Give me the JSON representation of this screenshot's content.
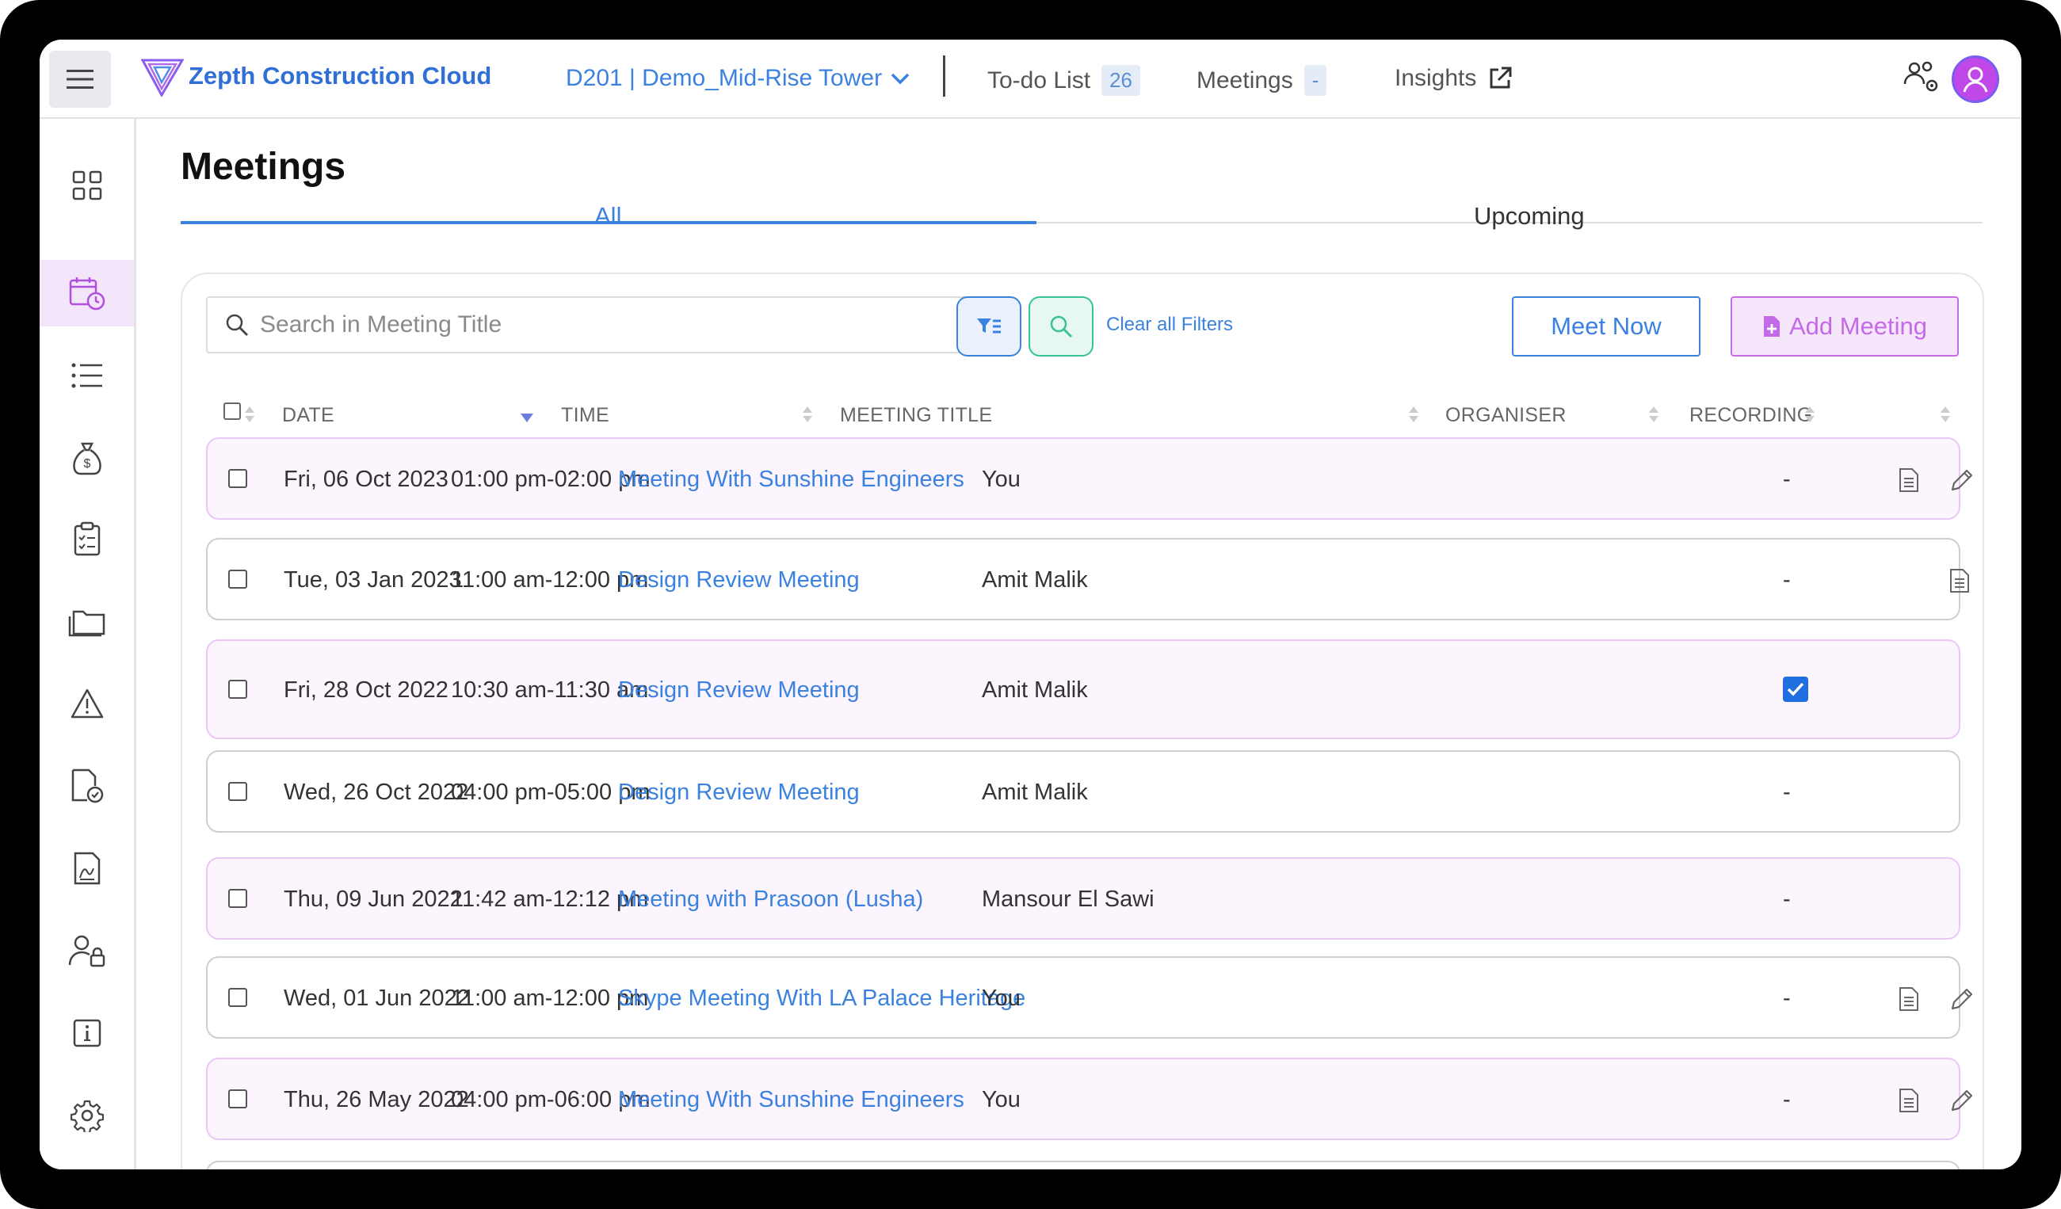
{
  "app": {
    "brand": "Zepth Construction Cloud",
    "project": "D201 | Demo_Mid-Rise Tower"
  },
  "nav": {
    "todo_label": "To-do List",
    "todo_count": "26",
    "meetings_label": "Meetings",
    "meetings_count": "-",
    "insights_label": "Insights"
  },
  "sidebar": {
    "items": [
      "dashboard-icon",
      "calendar-clock-icon",
      "list-icon",
      "money-bag-icon",
      "clipboard-checklist-icon",
      "folders-icon",
      "warning-icon",
      "document-check-icon",
      "drawing-document-icon",
      "user-lock-icon",
      "info-icon",
      "gear-icon"
    ],
    "active": 1
  },
  "page": {
    "title": "Meetings",
    "tabs": [
      "All",
      "Upcoming"
    ],
    "active_tab": "All"
  },
  "toolbar": {
    "search_placeholder": "Search in Meeting Title",
    "clear_filters": "Clear all Filters",
    "meet_now": "Meet Now",
    "add_meeting": "Add Meeting"
  },
  "table": {
    "headers": {
      "date": "DATE",
      "time": "TIME",
      "title": "MEETING TITLE",
      "organiser": "ORGANISER",
      "recording": "RECORDING"
    },
    "rows": [
      {
        "date": "Fri, 06 Oct 2023",
        "time": "01:00 pm-02:00 pm",
        "title": "Meeting With Sunshine Engineers",
        "organiser": "You",
        "recording": "-",
        "checked_recording": false,
        "actions": [
          "document-icon",
          "edit-icon"
        ],
        "highlight": true
      },
      {
        "date": "Tue, 03 Jan 2023",
        "time": "11:00 am-12:00 pm",
        "title": "Design Review Meeting",
        "organiser": "Amit Malik",
        "recording": "-",
        "checked_recording": false,
        "actions": [
          "document-icon"
        ],
        "highlight": false
      },
      {
        "date": "Fri, 28 Oct 2022",
        "time": "10:30 am-11:30 am",
        "title": "Design Review Meeting",
        "organiser": "Amit Malik",
        "recording": "",
        "checked_recording": true,
        "actions": [],
        "highlight": true
      },
      {
        "date": "Wed, 26 Oct 2022",
        "time": "04:00 pm-05:00 pm",
        "title": "Design Review Meeting",
        "organiser": "Amit Malik",
        "recording": "-",
        "checked_recording": false,
        "actions": [],
        "highlight": false
      },
      {
        "date": "Thu, 09 Jun 2022",
        "time": "11:42 am-12:12 pm",
        "title": "Meeting with Prasoon (Lusha)",
        "organiser": "Mansour El Sawi",
        "recording": "-",
        "checked_recording": false,
        "actions": [],
        "highlight": true
      },
      {
        "date": "Wed, 01 Jun 2022",
        "time": "11:00 am-12:00 pm",
        "title": "Skype Meeting With LA Palace Heritage",
        "organiser": "You",
        "recording": "-",
        "checked_recording": false,
        "actions": [
          "document-icon",
          "edit-icon"
        ],
        "highlight": false
      },
      {
        "date": "Thu, 26 May 2022",
        "time": "04:00 pm-06:00 pm",
        "title": "Meeting With Sunshine Engineers",
        "organiser": "You",
        "recording": "-",
        "checked_recording": false,
        "actions": [
          "document-icon",
          "edit-icon"
        ],
        "highlight": true
      }
    ]
  },
  "colors": {
    "accent": "#3b82e0",
    "brand_purple": "#c46ae8",
    "row_highlight": "#fcf5fe"
  }
}
